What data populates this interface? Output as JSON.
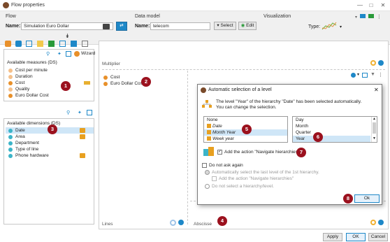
{
  "window": {
    "title": "Flow properties"
  },
  "header": {
    "flow_label": "Flow",
    "name_label": "Name:",
    "flow_name": "Simulation Euro Dollar",
    "data_model_label": "Data model",
    "data_model_name_label": "Name:",
    "data_model_value": "telecom",
    "select_label": "Select",
    "edit_label": "Edit",
    "visualization_label": "Visualization",
    "type_label": "Type:"
  },
  "left": {
    "wizard_label": "Wizard",
    "measures_title": "Available measures (DS)",
    "measures": [
      {
        "label": "Cost per minute",
        "dot": "light"
      },
      {
        "label": "Duration",
        "dot": "light"
      },
      {
        "label": "Cost",
        "dot": "dark"
      },
      {
        "label": "Quality",
        "dot": "light"
      },
      {
        "label": "Euro Dollar Cost",
        "dot": "dark"
      }
    ],
    "dimensions_title": "Available dimensions (DS)",
    "dimensions": [
      {
        "label": "Date",
        "hier": true,
        "selected": true
      },
      {
        "label": "Area",
        "hier": true,
        "selected": false
      },
      {
        "label": "Department",
        "hier": false,
        "selected": false
      },
      {
        "label": "Type of line",
        "hier": false,
        "selected": false
      },
      {
        "label": "Phone hardware",
        "hier": true,
        "selected": false
      }
    ]
  },
  "center": {
    "multiplier_label": "Multiplier",
    "measures": [
      "Cost",
      "Euro Dollar Cost"
    ],
    "lines_label": "Lines",
    "abscissa_label": "Abscisse"
  },
  "dialog": {
    "title": "Automatic selection of a level",
    "message_line1": "The level \"Year\" of the hierarchy \"Date\" has been selected automatically.",
    "message_line2": "You can change the selection.",
    "hierarchies": [
      {
        "label": "None",
        "italic": false,
        "selected": false
      },
      {
        "label": "Date",
        "italic": true,
        "selected": false
      },
      {
        "label": "Month Year",
        "italic": true,
        "selected": true
      },
      {
        "label": "Week year",
        "italic": true,
        "selected": false
      }
    ],
    "levels": [
      {
        "label": "Day",
        "selected": false
      },
      {
        "label": "Month",
        "selected": false
      },
      {
        "label": "Quarter",
        "selected": false
      },
      {
        "label": "Year",
        "selected": true
      }
    ],
    "navigate_label": "Add the action \"Navigate hierarchies\"",
    "do_not_ask_label": "Do not ask again",
    "auto_select_label": "Automatically select the last level of the 1st hierarchy.",
    "add_action_label": "Add the action \"Navigate hierarchies\"",
    "no_select_label": "Do not select a hierarchy/level.",
    "ok_label": "Ok"
  },
  "footer": {
    "apply_label": "Apply",
    "ok_label": "OK",
    "cancel_label": "Cancel"
  },
  "badges": [
    "1",
    "2",
    "3",
    "4",
    "5",
    "6",
    "7",
    "8"
  ],
  "colors": {
    "badge": "#9b111e",
    "accent_blue": "#1e88c8",
    "orange": "#e8902a",
    "selection": "#cfe6f7"
  }
}
